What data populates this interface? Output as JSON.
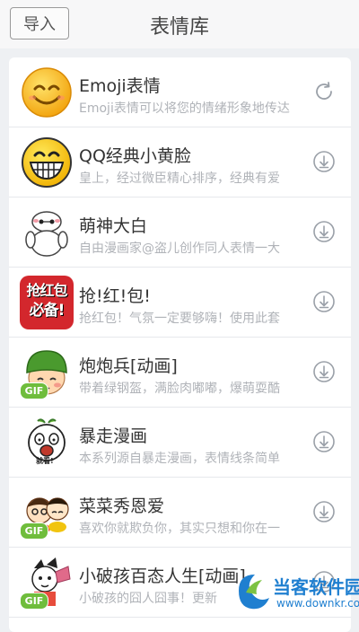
{
  "header": {
    "import_label": "导入",
    "title": "表情库"
  },
  "items": [
    {
      "name": "Emoji表情",
      "desc": "Emoji表情可以将您的情绪形象地传达",
      "action": "refresh-icon",
      "gif": false
    },
    {
      "name": "QQ经典小黄脸",
      "desc": "皇上，经过微臣精心排序，经典有爱",
      "action": "download-icon",
      "gif": false
    },
    {
      "name": "萌神大白",
      "desc": "自由漫画家@盗儿创作同人表情一大",
      "action": "download-icon",
      "gif": false
    },
    {
      "name": "抢!红!包!",
      "desc": "抢红包！气氛一定要够嗨！使用此套",
      "action": "download-icon",
      "gif": false
    },
    {
      "name": "炮炮兵[动画]",
      "desc": "带着绿钢盔，满脸肉嘟嘟，爆萌耍酷",
      "action": "download-icon",
      "gif": true,
      "gif_label": "GIF"
    },
    {
      "name": "暴走漫画",
      "desc": "本系列源自暴走漫画，表情线条简单",
      "action": "download-icon",
      "gif": false
    },
    {
      "name": "菜菜秀恩爱",
      "desc": "喜欢你就欺负你，其实只想和你在一",
      "action": "download-icon",
      "gif": true,
      "gif_label": "GIF"
    },
    {
      "name": "小破孩百态人生[动画]",
      "desc": "小破孩的囧人囧事！更新",
      "action": "download-icon",
      "gif": true,
      "gif_label": "GIF"
    }
  ],
  "thumb_badges": {
    "hongbao_line1": "抢红包",
    "hongbao_line2": "必备!",
    "baozou_caption": "就看!"
  },
  "watermark": {
    "name": "当客软件园",
    "url": "www.downkr.com"
  },
  "colors": {
    "accent": "#1f7fd0",
    "gif_badge": "#6fbd3c",
    "hongbao_red": "#d3272d"
  }
}
